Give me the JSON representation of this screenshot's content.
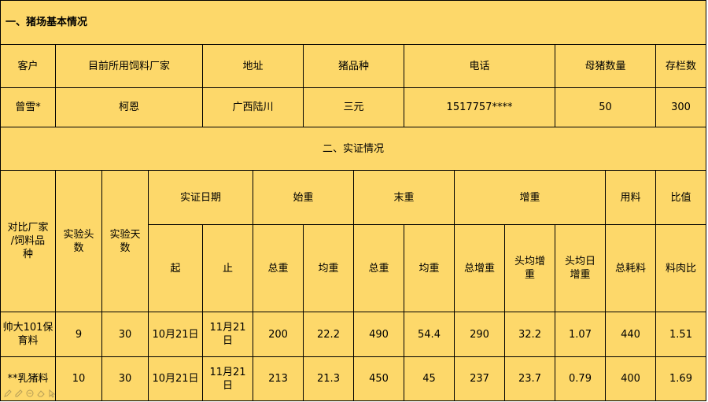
{
  "section1": {
    "title": "一、猪场基本情况",
    "headers": [
      "客户",
      "目前所用饲料厂家",
      "地址",
      "猪品种",
      "电话",
      "母猪数量",
      "存栏数"
    ],
    "values": [
      "曾雪*",
      "柯恩",
      "广西陆川",
      "三元",
      "1517757****",
      "50",
      "300"
    ]
  },
  "section2": {
    "title": "二、实证情况",
    "head": {
      "compare": "对比厂家\n/饲料品\n种",
      "heads": "实验头\n数",
      "days": "实验天\n数",
      "date": "实证日期",
      "start_weight": "始重",
      "end_weight": "末重",
      "gain": "增重",
      "feed": "用料",
      "ratio": "比值"
    },
    "sub": {
      "from": "起",
      "to": "止",
      "sw_total": "总重",
      "sw_avg": "均重",
      "ew_total": "总重",
      "ew_avg": "均重",
      "g_total": "总增重",
      "g_per_head": "头均增\n重",
      "g_daily": "头均日\n增重",
      "feed_total": "总耗料",
      "feed_meat_ratio": "料肉比"
    },
    "rows": [
      {
        "name": "帅大101保\n育料",
        "heads": "9",
        "days": "30",
        "from": "10月21日",
        "to": "11月21日",
        "sw_total": "200",
        "sw_avg": "22.2",
        "ew_total": "490",
        "ew_avg": "54.4",
        "g_total": "290",
        "g_per_head": "32.2",
        "g_daily": "1.07",
        "feed_total": "440",
        "ratio": "1.51"
      },
      {
        "name": "**乳猪料",
        "heads": "10",
        "days": "30",
        "from": "10月21日",
        "to": "11月21日",
        "sw_total": "213",
        "sw_avg": "21.3",
        "ew_total": "450",
        "ew_avg": "45",
        "g_total": "237",
        "g_per_head": "23.7",
        "g_daily": "0.79",
        "feed_total": "400",
        "ratio": "1.69"
      }
    ]
  },
  "toolbar_icons": [
    "pen-icon",
    "pencil-icon",
    "link-icon",
    "eraser-icon",
    "cursor-icon"
  ]
}
